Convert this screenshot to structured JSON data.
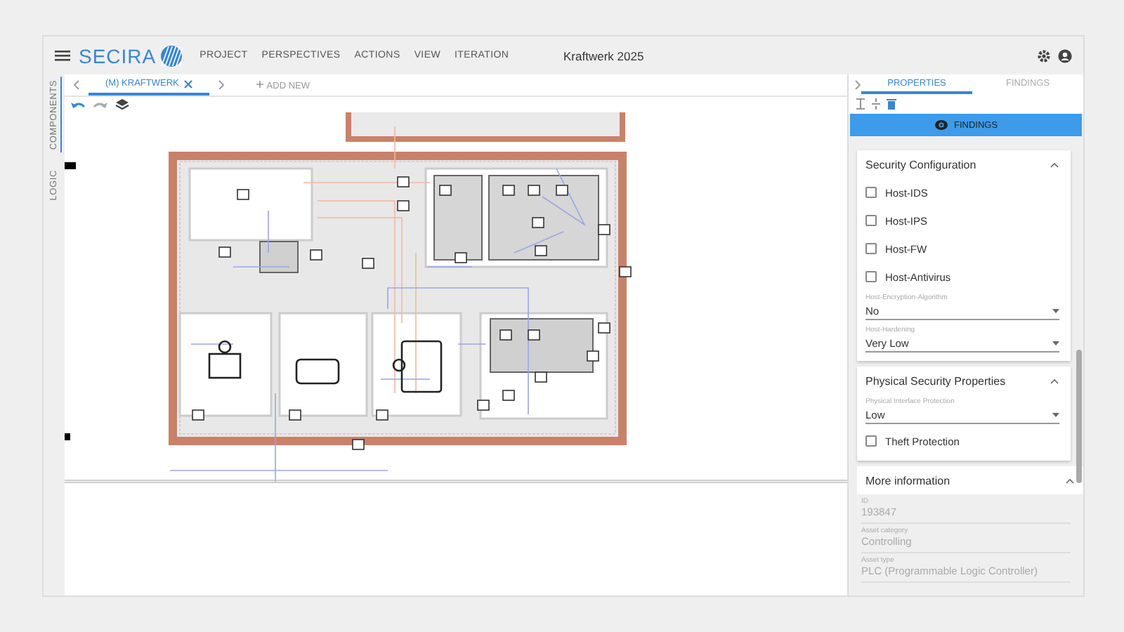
{
  "header": {
    "logo": "SECIRA",
    "menu": [
      "PROJECT",
      "PERSPECTIVES",
      "ACTIONS",
      "VIEW",
      "ITERATION"
    ],
    "title": "Kraftwerk 2025"
  },
  "side_tabs": [
    {
      "label": "COMPONENTS",
      "selected": true
    },
    {
      "label": "LOGIC",
      "selected": false
    }
  ],
  "editor_tabs": [
    {
      "label": "(M) KRAFTWERK",
      "selected": true
    }
  ],
  "add_new": "ADD NEW",
  "panel_tabs": [
    {
      "label": "PROPERTIES",
      "selected": true
    },
    {
      "label": "FINDINGS",
      "selected": false
    }
  ],
  "findings_button": "FINDINGS",
  "sections": [
    {
      "title": "Security Configuration",
      "expanded": true,
      "items": [
        {
          "kind": "checkbox",
          "label": "Host-IDS",
          "checked": false
        },
        {
          "kind": "checkbox",
          "label": "Host-IPS",
          "checked": false
        },
        {
          "kind": "checkbox",
          "label": "Host-FW",
          "checked": false
        },
        {
          "kind": "checkbox",
          "label": "Host-Antivirus",
          "checked": false
        },
        {
          "kind": "select",
          "label": "Host-Encryption-Algorithm",
          "value": "No"
        },
        {
          "kind": "select",
          "label": "Host-Hardening",
          "value": "Very Low"
        }
      ]
    },
    {
      "title": "Physical Security Properties",
      "expanded": true,
      "items": [
        {
          "kind": "select",
          "label": "Physical Interface Protection",
          "value": "Low"
        },
        {
          "kind": "checkbox",
          "label": "Theft Protection",
          "checked": false
        }
      ]
    },
    {
      "title": "More information",
      "expanded": true,
      "items": [
        {
          "kind": "readonly",
          "label": "ID",
          "value": "193847"
        },
        {
          "kind": "readonly",
          "label": "Asset category",
          "value": "Controlling"
        },
        {
          "kind": "readonly",
          "label": "Asset type",
          "value": "PLC (Programmable Logic Controller)"
        }
      ]
    }
  ]
}
